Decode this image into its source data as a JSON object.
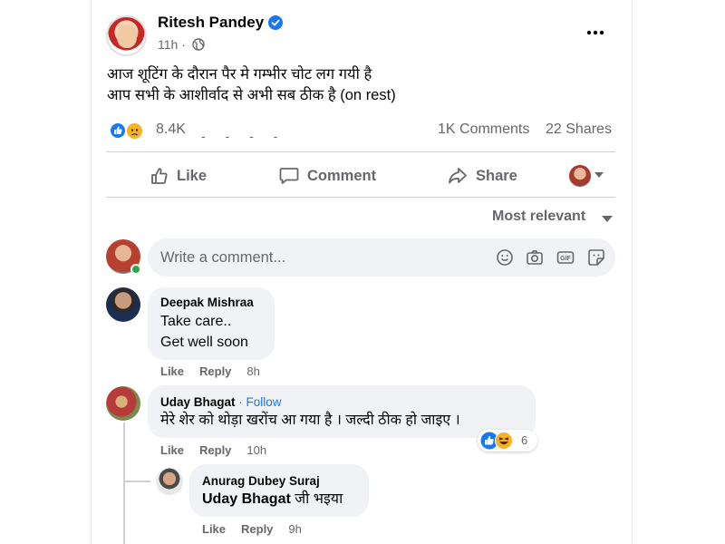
{
  "post": {
    "author": "Ritesh Pandey",
    "time": "11h ·",
    "text_line1": "आज शूटिंग के दौरान पैर मे गम्भीर चोट लग गयी है",
    "text_line2": "आप सभी के आशीर्वाद से अभी सब ठीक है (on rest)",
    "reaction_count": "8.4K",
    "comments_count": "1K Comments",
    "shares_count": "22 Shares"
  },
  "actions": {
    "like": "Like",
    "comment": "Comment",
    "share": "Share"
  },
  "sort": {
    "label": "Most relevant"
  },
  "composer": {
    "placeholder": "Write a comment..."
  },
  "comments": [
    {
      "name": "Deepak Mishraa",
      "line1": "Take care..",
      "line2": "Get well soon",
      "like": "Like",
      "reply": "Reply",
      "time": "8h"
    },
    {
      "name": "Uday Bhagat",
      "follow": "· Follow",
      "text": "मेरे शेर को थोड़ा खरोंच आ गया है । जल्दी ठीक हो जाइए ।",
      "like": "Like",
      "reply": "Reply",
      "time": "10h",
      "reactions": "6"
    },
    {
      "name": "Anurag Dubey Suraj",
      "mention": "Uday Bhagat",
      "rest": " जी भइया",
      "like": "Like",
      "reply": "Reply",
      "time": "9h"
    }
  ],
  "colors": {
    "accent": "#1877f2",
    "secondary_text": "#65676b",
    "bubble": "#f0f2f5",
    "online": "#31a24c"
  },
  "icons": [
    "verified-badge-icon",
    "globe-icon",
    "more-icon",
    "like-icon",
    "comment-icon",
    "share-icon",
    "caret-down-icon",
    "emoji-icon",
    "camera-icon",
    "gif-icon",
    "sticker-icon",
    "like-reaction-icon",
    "sad-reaction-icon",
    "haha-reaction-icon"
  ]
}
